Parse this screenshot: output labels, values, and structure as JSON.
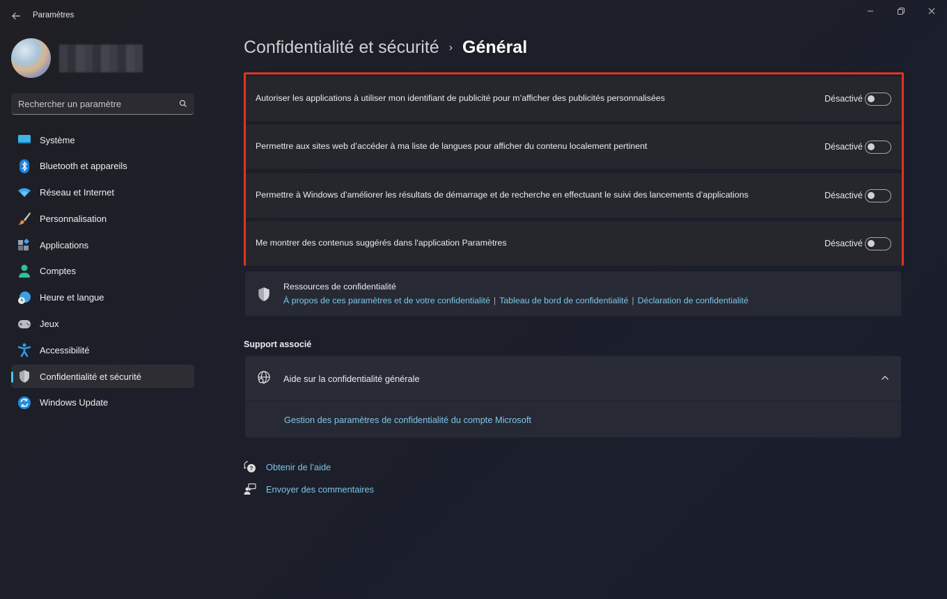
{
  "window": {
    "title": "Paramètres",
    "controls": {
      "minimize": "—",
      "maximize": "⧉",
      "close": "✕"
    }
  },
  "sidebar": {
    "search": {
      "placeholder": "Rechercher un paramètre",
      "value": ""
    },
    "items": [
      {
        "label": "Système",
        "icon": "display-icon",
        "active": false
      },
      {
        "label": "Bluetooth et appareils",
        "icon": "bluetooth-icon",
        "active": false
      },
      {
        "label": "Réseau et Internet",
        "icon": "wifi-icon",
        "active": false
      },
      {
        "label": "Personnalisation",
        "icon": "brush-icon",
        "active": false
      },
      {
        "label": "Applications",
        "icon": "apps-icon",
        "active": false
      },
      {
        "label": "Comptes",
        "icon": "person-icon",
        "active": false
      },
      {
        "label": "Heure et langue",
        "icon": "globe-clock-icon",
        "active": false
      },
      {
        "label": "Jeux",
        "icon": "gamepad-icon",
        "active": false
      },
      {
        "label": "Accessibilité",
        "icon": "accessibility-icon",
        "active": false
      },
      {
        "label": "Confidentialité et sécurité",
        "icon": "shield-icon",
        "active": true
      },
      {
        "label": "Windows Update",
        "icon": "update-icon",
        "active": false
      }
    ]
  },
  "main": {
    "breadcrumb": {
      "parent": "Confidentialité et sécurité",
      "separator": "›",
      "current": "Général"
    },
    "settings": [
      {
        "label": "Autoriser les applications à utiliser mon identifiant de publicité pour m’afficher des publicités personnalisées",
        "state": "Désactivé",
        "on": false
      },
      {
        "label": "Permettre aux sites web d’accéder à ma liste de langues pour afficher du contenu localement pertinent",
        "state": "Désactivé",
        "on": false
      },
      {
        "label": "Permettre à Windows d’améliorer les résultats de démarrage et de recherche en effectuant le suivi des lancements d’applications",
        "state": "Désactivé",
        "on": false
      },
      {
        "label": "Me montrer des contenus suggérés dans l'application Paramètres",
        "state": "Désactivé",
        "on": false
      }
    ],
    "highlight_color": "#e0341f",
    "resources": {
      "title": "Ressources de confidentialité",
      "links": [
        "À propos de ces paramètres et de votre confidentialité",
        "Tableau de bord de confidentialité",
        "Déclaration de confidentialité"
      ],
      "separator": "|"
    },
    "support": {
      "section_title": "Support associé",
      "card_label": "Aide sur la confidentialité générale",
      "expanded": true,
      "sub_link": "Gestion des paramètres de confidentialité du compte Microsoft"
    },
    "footer": {
      "get_help": "Obtenir de l’aide",
      "feedback": "Envoyer des commentaires"
    }
  }
}
